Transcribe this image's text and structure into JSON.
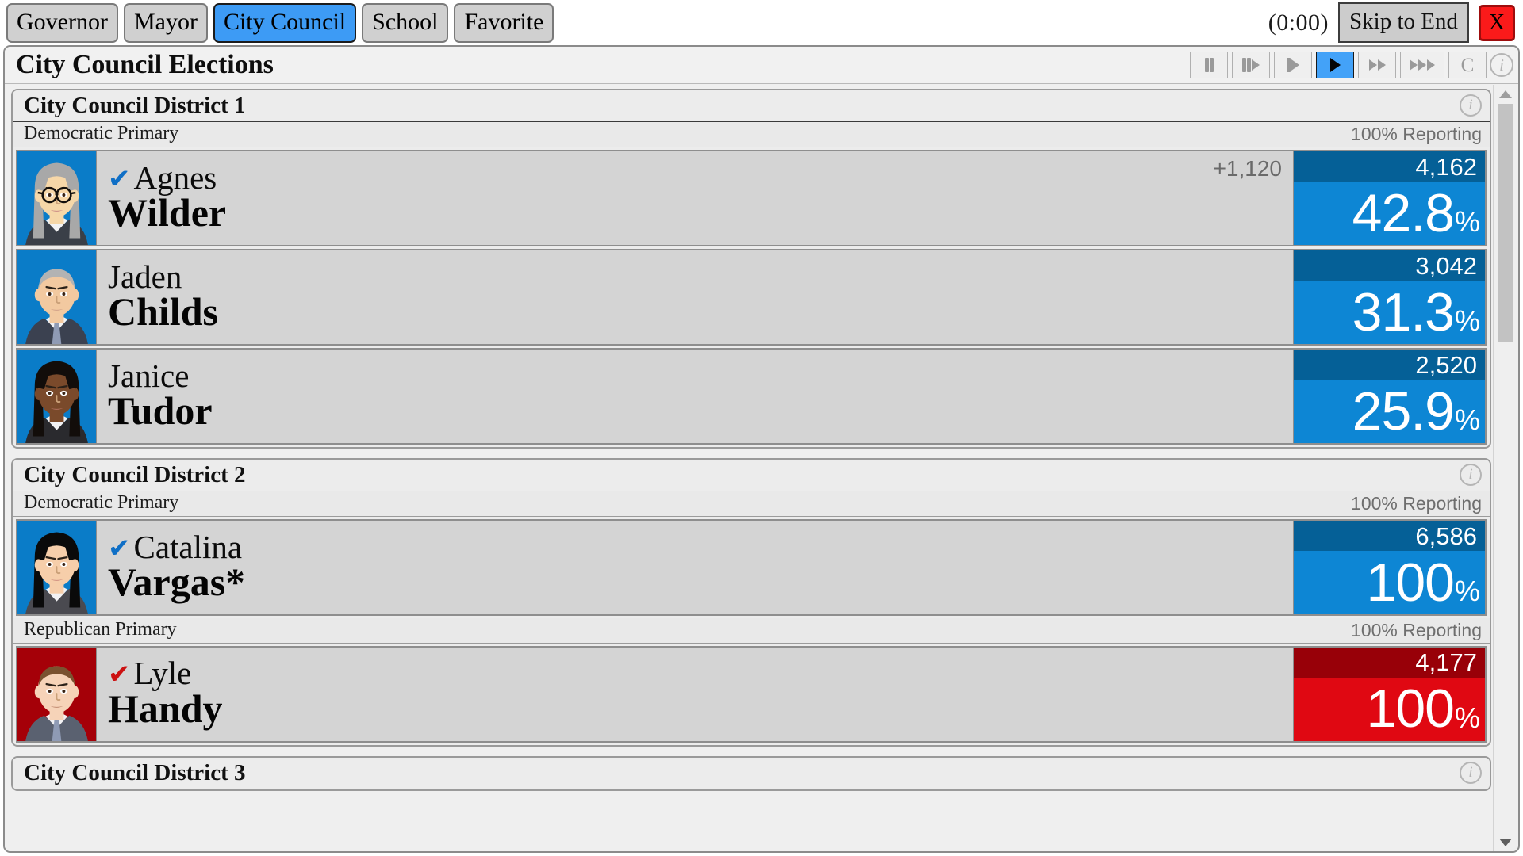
{
  "topbar": {
    "tabs": [
      {
        "label": "Governor",
        "active": false
      },
      {
        "label": "Mayor",
        "active": false
      },
      {
        "label": "City Council",
        "active": true
      },
      {
        "label": "School",
        "active": false
      },
      {
        "label": "Favorite",
        "active": false
      }
    ],
    "timer": "(0:00)",
    "skip_label": "Skip to End",
    "close_label": "X"
  },
  "panel": {
    "title": "City Council Elections",
    "controls": [
      {
        "name": "pause-button",
        "icon": "pause",
        "active": false
      },
      {
        "name": "rewind-step-button",
        "icon": "bars-play",
        "active": false
      },
      {
        "name": "step-button",
        "icon": "bar-play",
        "active": false
      },
      {
        "name": "play-button",
        "icon": "play",
        "active": true
      },
      {
        "name": "fast-forward-button",
        "icon": "double-play",
        "active": false
      },
      {
        "name": "very-fast-forward-button",
        "icon": "triple-play",
        "active": false
      },
      {
        "name": "c-button",
        "icon": "letter-c",
        "label": "C",
        "active": false
      }
    ],
    "info_label": "i"
  },
  "races": [
    {
      "name": "City Council District 1",
      "info_label": "i",
      "contests": [
        {
          "primary": "Democratic Primary",
          "reporting": "100% Reporting",
          "party": "dem",
          "candidates": [
            {
              "first": "Agnes",
              "last": "Wilder",
              "winner": true,
              "party": "dem",
              "margin": "+1,120",
              "votes": "4,162",
              "pct": "42.8",
              "pct_sign": "%",
              "avatar": "older-woman-glasses"
            },
            {
              "first": "Jaden",
              "last": "Childs",
              "winner": false,
              "party": "dem",
              "margin": "",
              "votes": "3,042",
              "pct": "31.3",
              "pct_sign": "%",
              "avatar": "older-man-suit"
            },
            {
              "first": "Janice",
              "last": "Tudor",
              "winner": false,
              "party": "dem",
              "margin": "",
              "votes": "2,520",
              "pct": "25.9",
              "pct_sign": "%",
              "avatar": "dark-haired-woman"
            }
          ]
        }
      ]
    },
    {
      "name": "City Council District 2",
      "info_label": "i",
      "contests": [
        {
          "primary": "Democratic Primary",
          "reporting": "100% Reporting",
          "party": "dem",
          "candidates": [
            {
              "first": "Catalina",
              "last": "Vargas*",
              "winner": true,
              "party": "dem",
              "margin": "",
              "votes": "6,586",
              "pct": "100",
              "pct_sign": "%",
              "avatar": "long-black-hair-woman"
            }
          ]
        },
        {
          "primary": "Republican Primary",
          "reporting": "100% Reporting",
          "party": "rep",
          "candidates": [
            {
              "first": "Lyle",
              "last": "Handy",
              "winner": true,
              "party": "rep",
              "margin": "",
              "votes": "4,177",
              "pct": "100",
              "pct_sign": "%",
              "avatar": "brown-hair-man"
            }
          ]
        }
      ]
    },
    {
      "name": "City Council District 3",
      "info_label": "i",
      "contests": []
    }
  ],
  "colors": {
    "dem_dark": "#056097",
    "dem_light": "#0d86d4",
    "rep_dark": "#980008",
    "rep_light": "#e00812",
    "active_tab": "#3d9bf5",
    "close": "#fb1a1a"
  },
  "checkmark_glyph": "✔"
}
